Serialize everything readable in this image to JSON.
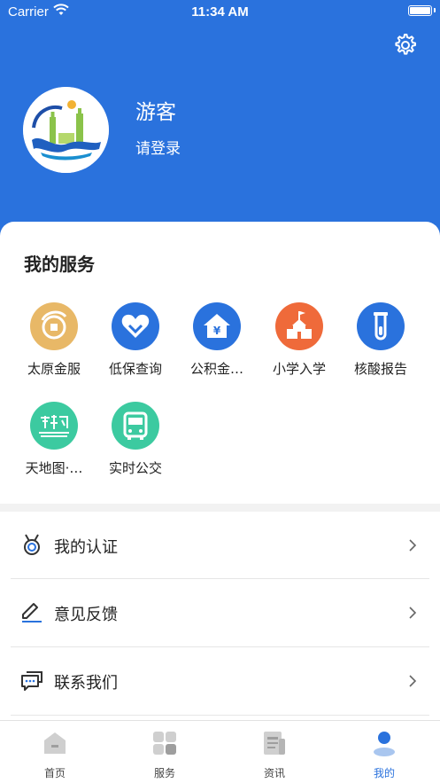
{
  "status_bar": {
    "carrier": "Carrier",
    "time": "11:34 AM"
  },
  "profile": {
    "name": "游客",
    "login": "请登录"
  },
  "services": {
    "title": "我的服务",
    "items": [
      {
        "label": "太原金服",
        "icon": "coin-icon",
        "color": "#e8b867"
      },
      {
        "label": "低保查询",
        "icon": "heart-icon",
        "color": "#2a72dd"
      },
      {
        "label": "公积金…",
        "icon": "house-yuan-icon",
        "color": "#2a72dd"
      },
      {
        "label": "小学入学",
        "icon": "school-icon",
        "color": "#ef6a3a"
      },
      {
        "label": "核酸报告",
        "icon": "test-tube-icon",
        "color": "#2a72dd"
      },
      {
        "label": "天地图·…",
        "icon": "map-world-icon",
        "color": "#3ccaa0"
      },
      {
        "label": "实时公交",
        "icon": "bus-icon",
        "color": "#3ccaa0"
      }
    ]
  },
  "menu": [
    {
      "label": "我的认证",
      "icon": "medal-icon"
    },
    {
      "label": "意见反馈",
      "icon": "edit-icon"
    },
    {
      "label": "联系我们",
      "icon": "chat-icon"
    }
  ],
  "tabs": [
    {
      "label": "首页",
      "icon": "home-icon",
      "active": false
    },
    {
      "label": "服务",
      "icon": "grid-icon",
      "active": false
    },
    {
      "label": "资讯",
      "icon": "news-icon",
      "active": false
    },
    {
      "label": "我的",
      "icon": "person-icon",
      "active": true
    }
  ],
  "theme": {
    "primary": "#2a72dd"
  }
}
